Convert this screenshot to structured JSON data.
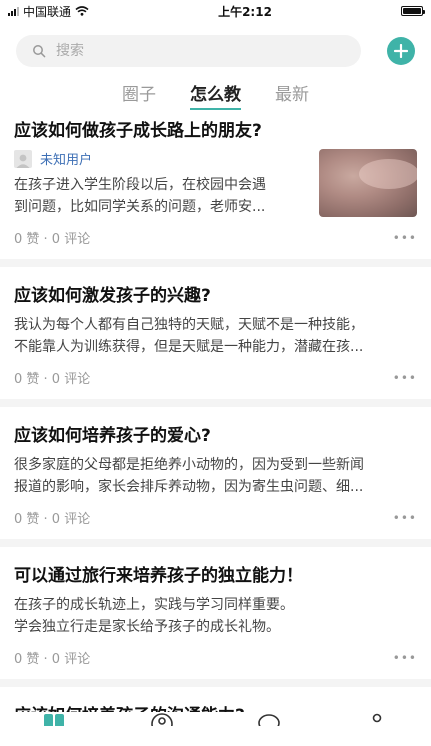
{
  "status_bar": {
    "carrier": "中国联通",
    "time": "上午2:12"
  },
  "search": {
    "placeholder": "搜索"
  },
  "tabs": [
    {
      "label": "圈子",
      "active": false
    },
    {
      "label": "怎么教",
      "active": true
    },
    {
      "label": "最新",
      "active": false
    }
  ],
  "colors": {
    "accent": "#3fb3a8",
    "author": "#3d6fb5"
  },
  "posts": [
    {
      "title": "应该如何做孩子成长路上的朋友?",
      "author": "未知用户",
      "excerpt_lines": [
        "在孩子进入学生阶段以后，在校园中会遇",
        "到问题，比如同学关系的问题，老师安..."
      ],
      "meta": "0 赞 · 0 评论"
    },
    {
      "title": "应该如何激发孩子的兴趣?",
      "excerpt_lines": [
        "我认为每个人都有自己独特的天赋，天赋不是一种技能，",
        "不能靠人为训练获得，但是天赋是一种能力，潜藏在孩..."
      ],
      "meta": "0 赞 · 0 评论"
    },
    {
      "title": "应该如何培养孩子的爱心?",
      "excerpt_lines": [
        "很多家庭的父母都是拒绝养小动物的，因为受到一些新闻",
        "报道的影响，家长会排斥养动物，因为寄生虫问题、细..."
      ],
      "meta": "0 赞 · 0 评论"
    },
    {
      "title": "可以通过旅行来培养孩子的独立能力！",
      "excerpt_lines": [
        "在孩子的成长轨迹上，实践与学习同样重要。",
        "学会独立行走是家长给予孩子的成长礼物。"
      ],
      "meta": "0 赞 · 0 评论"
    },
    {
      "title": "应该如何培养孩子的沟通能力?"
    }
  ]
}
